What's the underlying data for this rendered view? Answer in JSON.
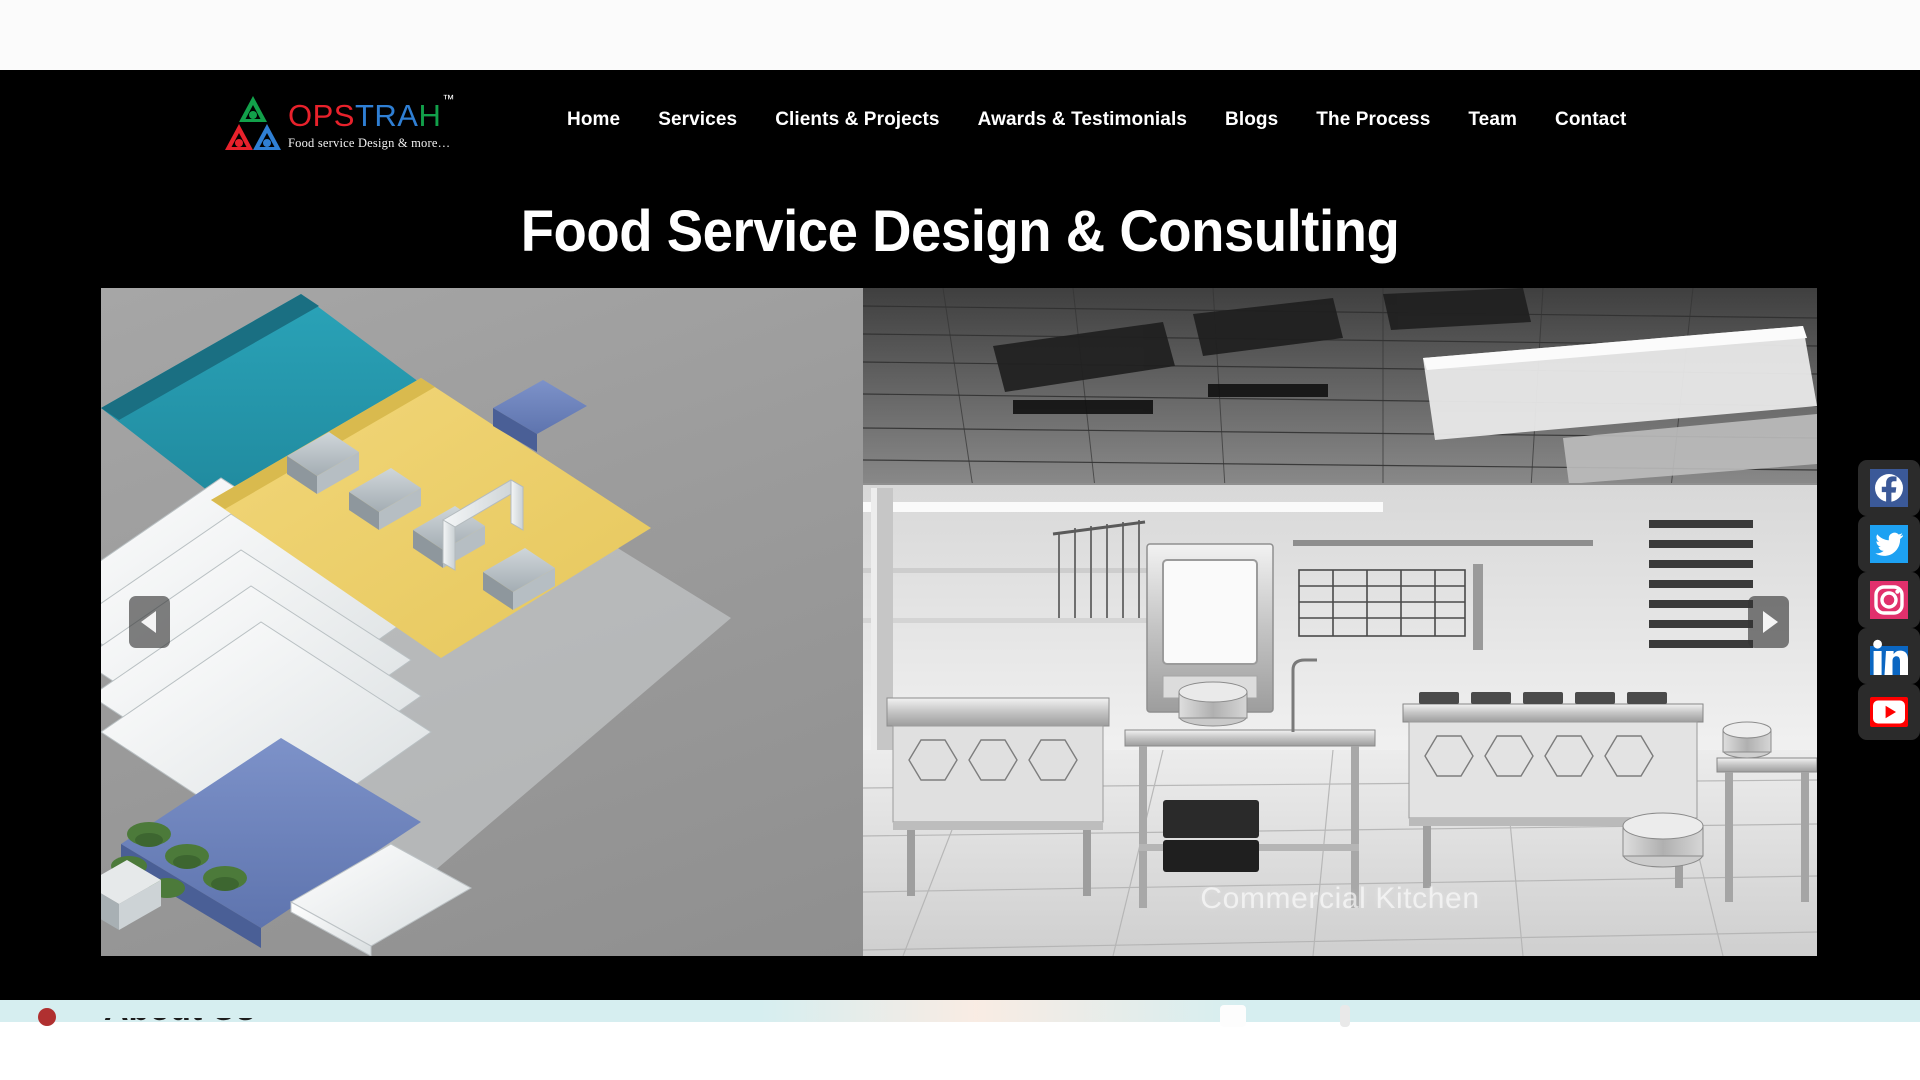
{
  "brand": {
    "name_parts": [
      {
        "text": "OPS",
        "color": "#e8212b"
      },
      {
        "text": "TRA",
        "color": "#2f7fd4"
      },
      {
        "text": "H",
        "color": "#12a04a"
      }
    ],
    "name_full": "OPSTRAH",
    "trademark": "™",
    "tagline": "Food service Design & more…",
    "logo_icon": "triangle-people-logo"
  },
  "nav": {
    "items": [
      {
        "label": "Home",
        "name": "nav-home"
      },
      {
        "label": "Services",
        "name": "nav-services"
      },
      {
        "label": "Clients & Projects",
        "name": "nav-clients-projects"
      },
      {
        "label": "Awards & Testimonials",
        "name": "nav-awards-testimonials"
      },
      {
        "label": "Blogs",
        "name": "nav-blogs"
      },
      {
        "label": "The Process",
        "name": "nav-the-process"
      },
      {
        "label": "Team",
        "name": "nav-team"
      },
      {
        "label": "Contact",
        "name": "nav-contact"
      }
    ]
  },
  "hero": {
    "title": "Food Service Design & Consulting"
  },
  "carousel": {
    "prev_label": "◀",
    "next_label": "▶",
    "slides": [
      {
        "name": "isometric-kitchen-layout",
        "caption": "",
        "alt": "Isometric 3D render of a food service facility layout"
      },
      {
        "name": "commercial-kitchen-render",
        "caption": "Commercial Kitchen",
        "alt": "Greyscale 3D render of a commercial kitchen interior"
      }
    ]
  },
  "social": {
    "items": [
      {
        "label": "Facebook",
        "icon": "facebook-icon",
        "color": "#3b5998"
      },
      {
        "label": "Twitter",
        "icon": "twitter-icon",
        "color": "#1da1f2"
      },
      {
        "label": "Instagram",
        "icon": "instagram-icon",
        "color": "#e1306c"
      },
      {
        "label": "LinkedIn",
        "icon": "linkedin-icon",
        "color": "#0a66c2"
      },
      {
        "label": "YouTube",
        "icon": "youtube-icon",
        "color": "#ff0000"
      }
    ]
  },
  "below_fold": {
    "heading": "About Us",
    "band_color": "#d6eef0"
  },
  "colors": {
    "header_bg": "#000000",
    "page_bg": "#fbfbfb",
    "nav_text": "#ffffff"
  }
}
